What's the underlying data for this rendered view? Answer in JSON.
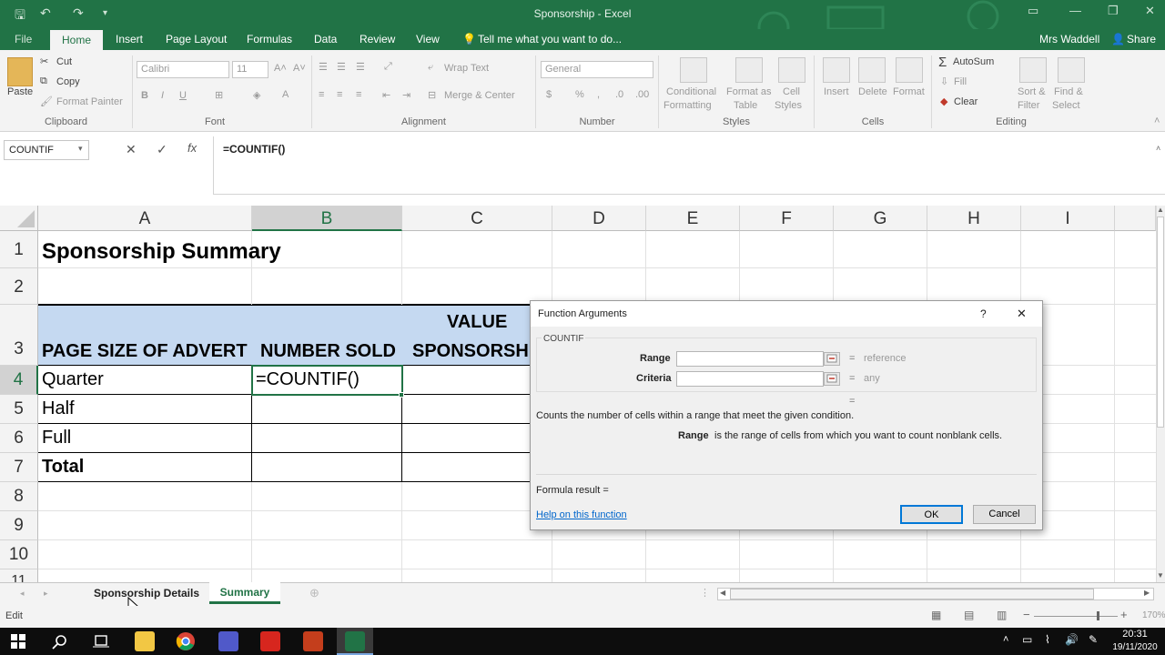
{
  "window": {
    "title": "Sponsorship - Excel",
    "account": "Mrs Waddell",
    "share_label": "Share"
  },
  "tabs": [
    "File",
    "Home",
    "Insert",
    "Page Layout",
    "Formulas",
    "Data",
    "Review",
    "View"
  ],
  "tell_me": "Tell me what you want to do...",
  "ribbon": {
    "clipboard": {
      "paste": "Paste",
      "cut": "Cut",
      "copy": "Copy",
      "format_painter": "Format Painter",
      "group": "Clipboard"
    },
    "font": {
      "name": "Calibri",
      "size": "11",
      "group": "Font"
    },
    "alignment": {
      "wrap_text": "Wrap Text",
      "merge_center": "Merge & Center",
      "group": "Alignment"
    },
    "number": {
      "format": "General",
      "group": "Number"
    },
    "styles": {
      "conditional": "Conditional",
      "conditional2": "Formatting",
      "format_as": "Format as",
      "format_as2": "Table",
      "cell_styles": "Cell",
      "cell_styles2": "Styles",
      "group": "Styles"
    },
    "cells": {
      "insert": "Insert",
      "delete": "Delete",
      "format": "Format",
      "group": "Cells"
    },
    "editing": {
      "autosum": "AutoSum",
      "fill": "Fill",
      "clear": "Clear",
      "sort": "Sort &",
      "sort2": "Filter",
      "find": "Find &",
      "find2": "Select",
      "group": "Editing"
    }
  },
  "formula_bar": {
    "name_box": "COUNTIF",
    "formula": "=COUNTIF()"
  },
  "columns": [
    "A",
    "B",
    "C",
    "D",
    "E",
    "F",
    "G",
    "H",
    "I"
  ],
  "rows": [
    "1",
    "2",
    "3",
    "4",
    "5",
    "6",
    "7",
    "8",
    "9",
    "10",
    "11"
  ],
  "cells": {
    "a1": "Sponsorship Summary",
    "a3": "PAGE SIZE OF ADVERT",
    "b3": "NUMBER SOLD",
    "c3_top": "VALUE",
    "c3": "SPONSORSHI",
    "a4": "Quarter",
    "b4": "=COUNTIF()",
    "a5": "Half",
    "a6": "Full",
    "a7": "Total"
  },
  "dialog": {
    "title": "Function Arguments",
    "help_glyph": "?",
    "close_glyph": "✕",
    "function_name": "COUNTIF",
    "arg1_label": "Range",
    "arg1_hint": "reference",
    "arg2_label": "Criteria",
    "arg2_hint": "any",
    "equals": "=",
    "description": "Counts the number of cells within a range that meet the given condition.",
    "arg_desc_name": "Range",
    "arg_desc": "is the range of cells from which you want to count nonblank cells.",
    "formula_result": "Formula result =",
    "help_link": "Help on this function",
    "ok": "OK",
    "cancel": "Cancel"
  },
  "sheets": [
    "Sponsorship Details",
    "Summary"
  ],
  "status": {
    "mode": "Edit",
    "zoom": "170%"
  },
  "taskbar": {
    "time": "20:31",
    "date": "19/11/2020"
  },
  "colors": {
    "excel_green": "#217346",
    "header_fill": "#c5d9f1",
    "selection_green": "#217346"
  }
}
